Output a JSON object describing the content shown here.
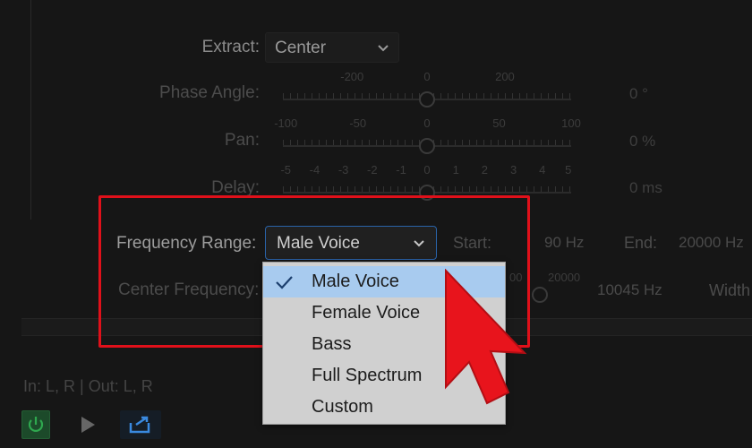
{
  "extract": {
    "label": "Extract:",
    "value": "Center"
  },
  "phase_angle": {
    "label": "Phase Angle:",
    "value": "0 °",
    "ticks": [
      "-200",
      "0",
      "200"
    ]
  },
  "pan": {
    "label": "Pan:",
    "value": "0 %",
    "ticks": [
      "-100",
      "-50",
      "0",
      "50",
      "100"
    ]
  },
  "delay": {
    "label": "Delay:",
    "value": "0 ms",
    "ticks": [
      "-5",
      "-4",
      "-3",
      "-2",
      "-1",
      "0",
      "1",
      "2",
      "3",
      "4",
      "5"
    ]
  },
  "frequency_range": {
    "label": "Frequency Range:",
    "value": "Male Voice",
    "options": [
      {
        "label": "Male Voice",
        "selected": true
      },
      {
        "label": "Female Voice",
        "selected": false
      },
      {
        "label": "Bass",
        "selected": false
      },
      {
        "label": "Full Spectrum",
        "selected": false
      },
      {
        "label": "Custom",
        "selected": false
      }
    ]
  },
  "start": {
    "label": "Start:",
    "value": "90 Hz"
  },
  "end": {
    "label": "End:",
    "value": "20000 Hz"
  },
  "center_frequency": {
    "label": "Center Frequency:",
    "value": "10045 Hz",
    "tick_partial": "00",
    "tick_max": "20000"
  },
  "width": {
    "label": "Width"
  },
  "io": {
    "label": "In: L, R | Out: L, R"
  },
  "colors": {
    "highlight": "#e0101a",
    "cursor": "#e8141c",
    "selection": "#a8cbef",
    "focus_border": "#2a63a8",
    "power": "#2fa84f",
    "export": "#3a8ae0"
  },
  "icons": {
    "dropdown": "chevron-down-icon",
    "check": "check-icon",
    "power": "power-icon",
    "play": "play-icon",
    "export": "export-icon",
    "cursor": "arrow-cursor-icon"
  }
}
